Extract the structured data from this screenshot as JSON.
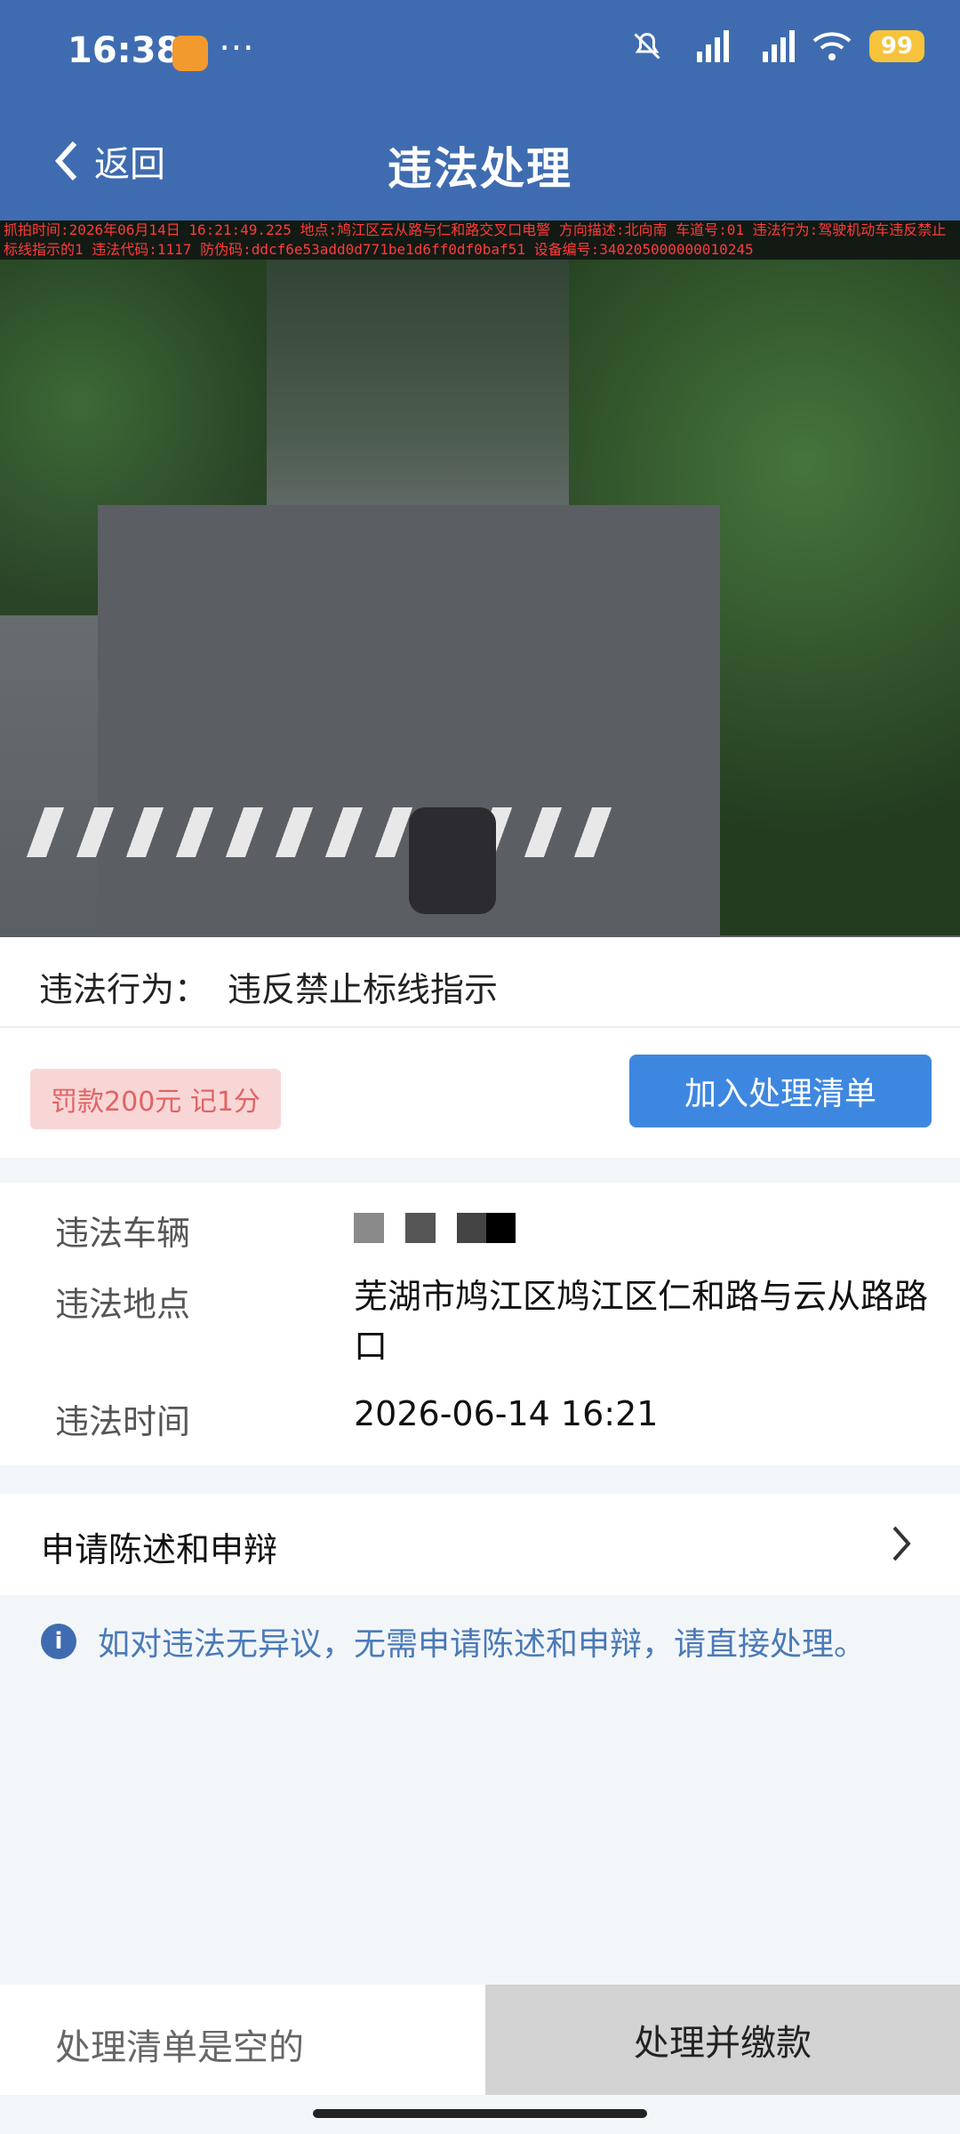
{
  "status_bar": {
    "time": "16:38",
    "battery": "99"
  },
  "nav": {
    "back_label": "返回",
    "title": "违法处理"
  },
  "photo": {
    "overlay_text": "抓拍时间:2026年06月14日 16:21:49.225 地点:鸠江区云从路与仁和路交叉口电警 方向描述:北向南 车道号:01 违法行为:驾驶机动车违反禁止标线指示的1 违法代码:1117 防伪码:ddcf6e53add0d771be1d6ff0df0baf51 设备编号:340205000000010245"
  },
  "violation": {
    "label": "违法行为：",
    "value": "违反禁止标线指示"
  },
  "actions": {
    "fine": "罚款200元 记1分",
    "add_button": "加入处理清单"
  },
  "details": {
    "vehicle_label": "违法车辆",
    "location_label": "违法地点",
    "location_value": "芜湖市鸠江区鸠江区仁和路与云从路路口",
    "time_label": "违法时间",
    "time_value": "2026-06-14 16:21"
  },
  "statement": {
    "label": "申请陈述和申辩"
  },
  "tip": {
    "text": "如对违法无异议，无需申请陈述和申辩，请直接处理。"
  },
  "bottom": {
    "empty_text": "处理清单是空的",
    "pay_button": "处理并缴款"
  },
  "colors": {
    "header": "#3f6cb0",
    "primary_button": "#3e87e0",
    "fine_bg": "#f9d6d6",
    "fine_text": "#e26363"
  }
}
